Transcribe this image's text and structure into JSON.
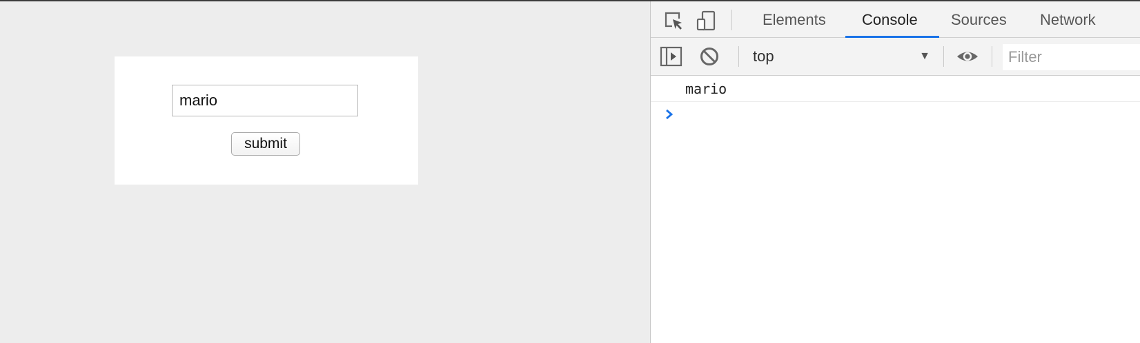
{
  "page": {
    "input_value": "mario",
    "submit_label": "submit"
  },
  "devtools": {
    "tabs": [
      "Elements",
      "Console",
      "Sources",
      "Network"
    ],
    "active_tab": "Console",
    "context": "top",
    "filter_placeholder": "Filter",
    "console_messages": [
      "mario"
    ],
    "accent_color": "#1a73e8"
  },
  "icons": {
    "inspect": "select-element-icon",
    "device": "device-toolbar-icon",
    "sidebar": "show-console-sidebar-icon",
    "clear": "clear-console-icon",
    "eye": "live-expression-eye-icon",
    "prompt": "console-prompt-chevron-icon"
  }
}
